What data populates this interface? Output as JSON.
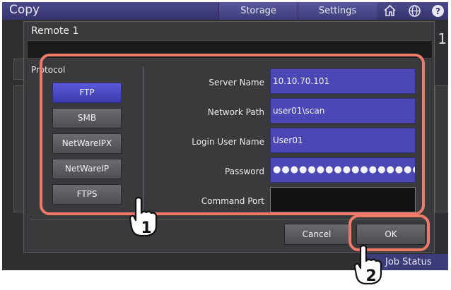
{
  "app": {
    "title": "Copy"
  },
  "topbar": {
    "tabs": [
      "Storage",
      "Settings"
    ],
    "icons": [
      "home-icon",
      "globe-icon",
      "help-icon"
    ]
  },
  "background": {
    "right_digit": "1",
    "job_status": "Job Status"
  },
  "dialog": {
    "title": "Remote 1",
    "protocol": {
      "label": "Protocol",
      "options": [
        "FTP",
        "SMB",
        "NetWareIPX",
        "NetWareIP",
        "FTPS"
      ],
      "selected": "FTP"
    },
    "fields": {
      "server_name": {
        "label": "Server Name",
        "value": "10.10.70.101"
      },
      "network_path": {
        "label": "Network Path",
        "value": "user01\\scan"
      },
      "login_user_name": {
        "label": "Login User Name",
        "value": "User01"
      },
      "password": {
        "label": "Password",
        "value": "●●●●●●●●●●●●●●●●●●●●●"
      },
      "command_port": {
        "label": "Command Port",
        "value": ""
      }
    },
    "buttons": {
      "cancel": "Cancel",
      "ok": "OK"
    }
  },
  "callouts": [
    "1",
    "2"
  ],
  "colors": {
    "accent": "#4b48b6",
    "selected": "#4646c4",
    "callout": "#ee7a6a",
    "topbar": "#3f3e7c"
  }
}
